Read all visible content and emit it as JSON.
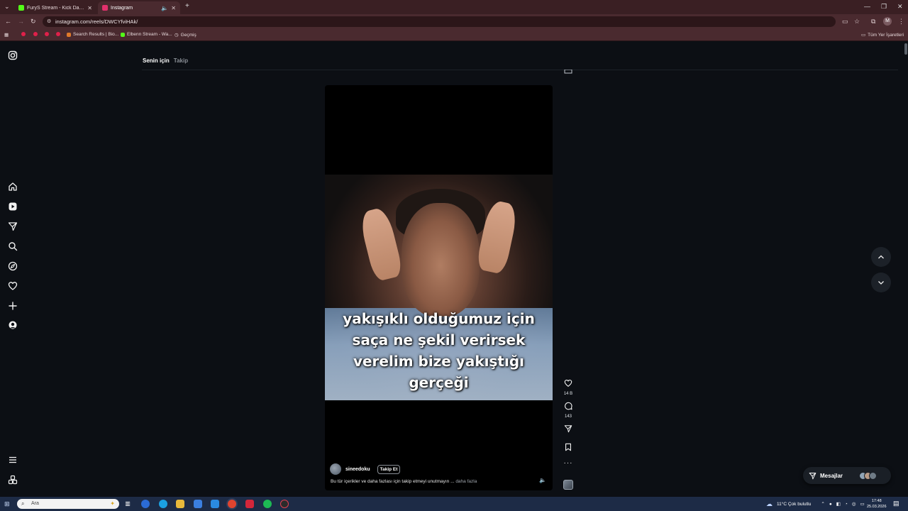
{
  "browser": {
    "tabs": [
      {
        "title": "FuryS Stream - Kick Dashboard",
        "favicon_color": "#53fc18",
        "active": false
      },
      {
        "title": "Instagram",
        "favicon_color": "#e1306c",
        "active": true
      }
    ],
    "url": "instagram.com/reels/DWCYfviHAk/",
    "bookmarks": [
      {
        "label": "Search Results | Bio..."
      },
      {
        "label": "Elbenn Stream - Wa..."
      },
      {
        "label": "Geçmiş"
      }
    ],
    "all_bookmarks_label": "Tüm Yer İşaretleri",
    "profile_initial": "M"
  },
  "feed": {
    "tabs": [
      {
        "label": "Senin için",
        "active": true
      },
      {
        "label": "Takip",
        "active": false
      }
    ]
  },
  "reel": {
    "caption": "yakışıklı olduğumuz için saça ne şekil verirsek verelim bize yakıştığı gerçeği",
    "username": "sineedoku",
    "follow_label": "Takip Et",
    "description": "Bu tür içerikler ve daha fazlası için takip etmeyi unutmayın ...",
    "more_label": "daha fazla",
    "likes": "14 B",
    "comments": "143"
  },
  "messages": {
    "label": "Mesajlar"
  },
  "taskbar": {
    "search_placeholder": "Ara",
    "weather": "11°C  Çok bulutlu",
    "time": "17:48",
    "date": "25.03.2026"
  },
  "colors": {
    "accent_instagram": "#e1306c",
    "kick_green": "#53fc18",
    "chrome_frame": "#4a2a2f"
  }
}
